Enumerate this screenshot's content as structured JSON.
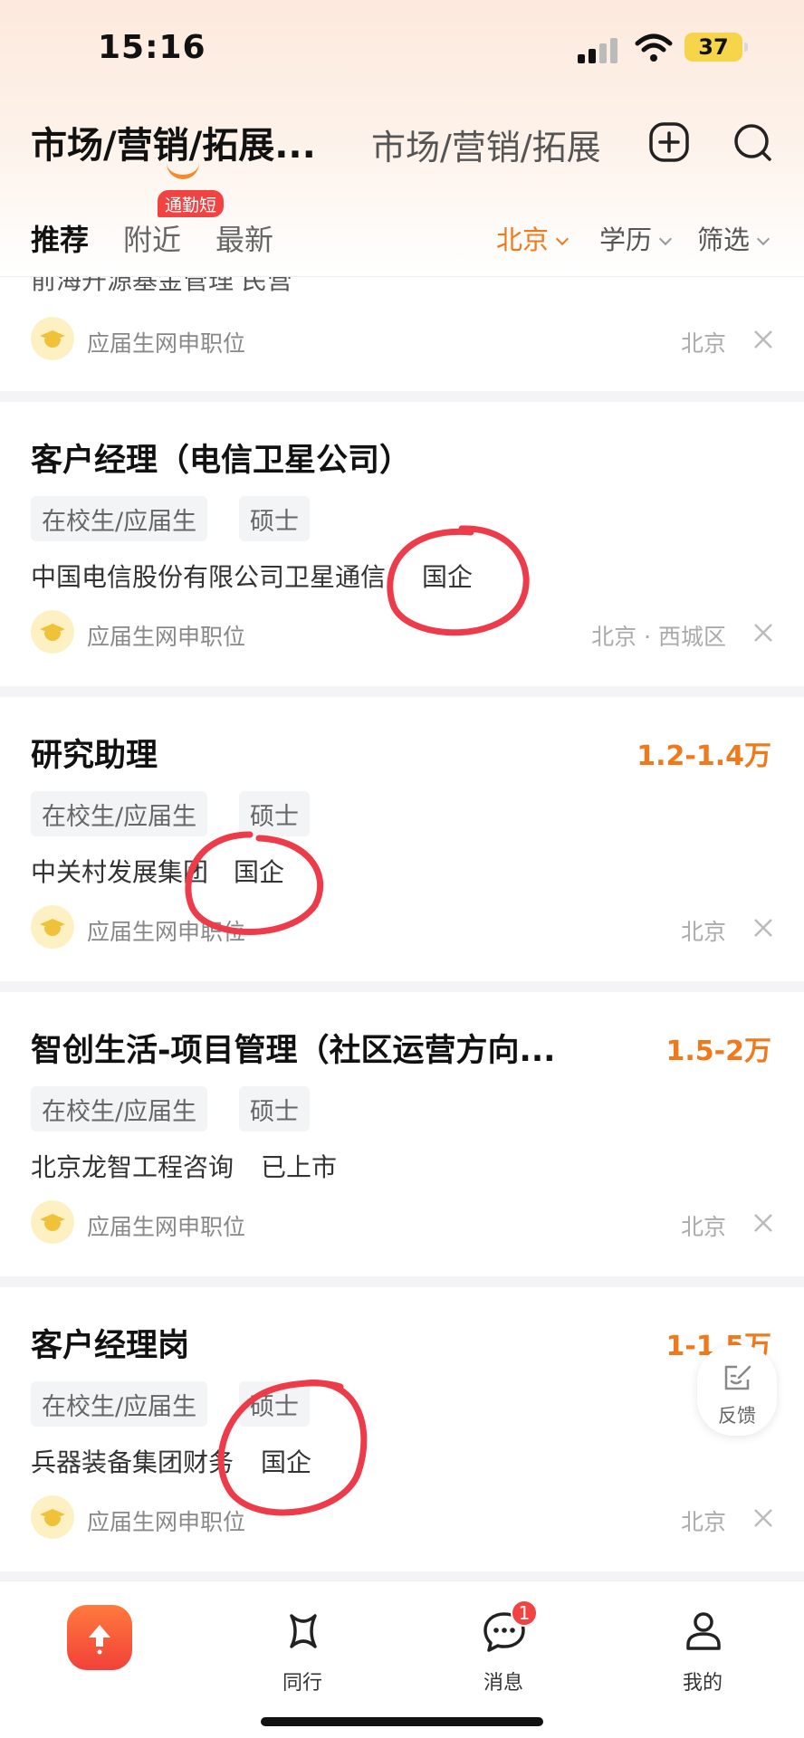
{
  "status_bar": {
    "time": "15:16",
    "battery": "37"
  },
  "header": {
    "title": "市场/营销/拓展...",
    "title_secondary": "市场/营销/拓展",
    "tabs": [
      {
        "label": "推荐",
        "active": true
      },
      {
        "label": "附近",
        "badge": "通勤短"
      },
      {
        "label": "最新"
      }
    ],
    "filters": [
      {
        "label": "北京",
        "accent": true
      },
      {
        "label": "学历"
      },
      {
        "label": "筛选"
      }
    ]
  },
  "partial_card": {
    "company_cut": "前海开源基金管理  民营",
    "source": "应届生网申职位",
    "location": "北京"
  },
  "jobs": [
    {
      "title": "客户经理（电信卫星公司）",
      "salary": "",
      "tags": [
        "在校生/应届生",
        "硕士"
      ],
      "company": "中国电信股份有限公司卫星通信",
      "company_type": "国企",
      "source": "应届生网申职位",
      "location": "北京 · 西城区"
    },
    {
      "title": "研究助理",
      "salary": "1.2-1.4万",
      "tags": [
        "在校生/应届生",
        "硕士"
      ],
      "company": "中关村发展集团",
      "company_type": "国企",
      "source": "应届生网申职位",
      "location": "北京"
    },
    {
      "title": "智创生活-项目管理（社区运营方向...",
      "salary": "1.5-2万",
      "tags": [
        "在校生/应届生",
        "硕士"
      ],
      "company": "北京龙智工程咨询",
      "company_type": "已上市",
      "source": "应届生网申职位",
      "location": "北京"
    },
    {
      "title": "客户经理岗",
      "salary": "1-1.5万",
      "tags": [
        "在校生/应届生",
        "硕士"
      ],
      "company": "兵器装备集团财务",
      "company_type": "国企",
      "source": "应届生网申职位",
      "location": "北京"
    }
  ],
  "feedback": {
    "label": "反馈"
  },
  "bottom_nav": [
    {
      "label": "",
      "icon": "upload-icon"
    },
    {
      "label": "同行",
      "icon": "peer-icon"
    },
    {
      "label": "消息",
      "icon": "message-icon",
      "badge": "1"
    },
    {
      "label": "我的",
      "icon": "profile-icon"
    }
  ],
  "colors": {
    "accent": "#f07a1b",
    "badge": "#f24343",
    "annotation": "#ee3b4a"
  }
}
